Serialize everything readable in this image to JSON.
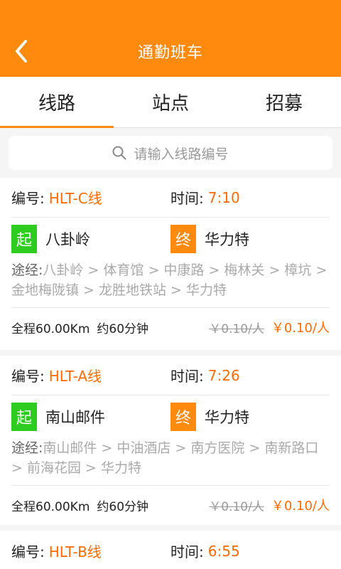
{
  "header": {
    "title": "通勤班车",
    "back_icon": "chevron-left-icon"
  },
  "tabs": [
    {
      "label": "线路",
      "active": true
    },
    {
      "label": "站点",
      "active": false
    },
    {
      "label": "招募",
      "active": false
    }
  ],
  "search": {
    "placeholder": "请输入线路编号",
    "icon": "search-icon"
  },
  "labels": {
    "number": "编号:",
    "time": "时间:",
    "via": "途经:",
    "start_badge": "起",
    "end_badge": "终"
  },
  "routes": [
    {
      "number": "HLT-C线",
      "time": "7:10",
      "start": "八卦岭",
      "end": "华力特",
      "via": "八卦岭 > 体育馆 > 中康路 > 梅林关 > 樟坑 > 金地梅陇镇 > 龙胜地铁站 > 华力特",
      "distance": "全程60.00Km",
      "duration": "约60分钟",
      "old_price": "￥0.10/人",
      "price": "￥0.10/人"
    },
    {
      "number": "HLT-A线",
      "time": "7:26",
      "start": "南山邮件",
      "end": "华力特",
      "via": "南山邮件 > 中油酒店 > 南方医院 > 南新路口 > 前海花园 > 华力特",
      "distance": "全程60.00Km",
      "duration": "约60分钟",
      "old_price": "￥0.10/人",
      "price": "￥0.10/人"
    },
    {
      "number": "HLT-B线",
      "time": "6:55"
    }
  ],
  "colors": {
    "accent": "#ff8a0d",
    "price": "#ff6b00",
    "start_badge": "#2ecc20"
  }
}
